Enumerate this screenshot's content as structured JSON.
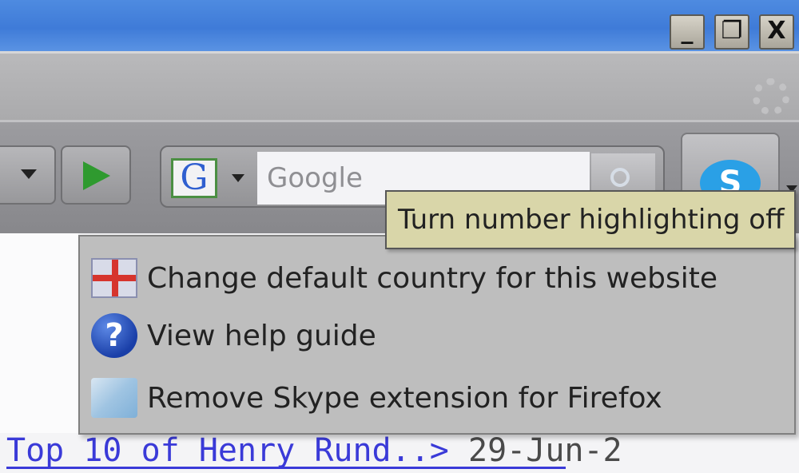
{
  "window": {
    "controls": {
      "minimize_label": "_",
      "restore_label": "❐",
      "close_label": "X"
    }
  },
  "toolbar": {
    "search": {
      "engine_letter": "G",
      "placeholder": "Google"
    },
    "skype_label": "S"
  },
  "tooltip": {
    "text": "Turn number highlighting off"
  },
  "context_menu": {
    "items": [
      {
        "icon": "flag-icon",
        "label": "Change default country for this website"
      },
      {
        "icon": "help-icon",
        "glyph": "?",
        "label": "View help guide"
      },
      {
        "icon": "cube-icon",
        "label": "Remove Skype extension for Firefox"
      }
    ]
  },
  "page": {
    "link_text": "Top 10 of Henry Rund..>",
    "date_text": "29-Jun-2"
  },
  "colors": {
    "titlebar": "#4e8be0",
    "tooltip_bg": "#d9d6a9",
    "menu_bg": "#bebebe",
    "link": "#3a3ad8"
  }
}
